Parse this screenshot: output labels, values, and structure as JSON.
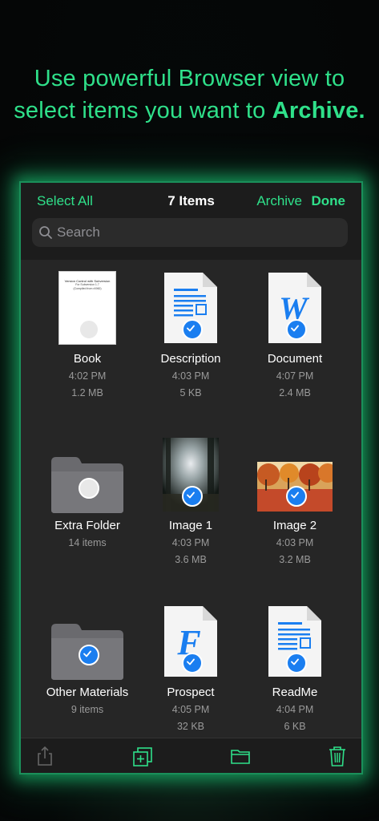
{
  "headline": {
    "line1": "Use powerful Browser view to",
    "line2_prefix": "select items you want to ",
    "line2_bold": "Archive."
  },
  "nav": {
    "select_all": "Select All",
    "title": "7 Items",
    "archive": "Archive",
    "done": "Done"
  },
  "search": {
    "placeholder": "Search"
  },
  "items": [
    {
      "name": "Book",
      "time": "4:02 PM",
      "size": "1.2 MB",
      "kind": "book",
      "selected": false
    },
    {
      "name": "Description",
      "time": "4:03 PM",
      "size": "5 KB",
      "kind": "doc",
      "selected": true
    },
    {
      "name": "Document",
      "time": "4:07 PM",
      "size": "2.4 MB",
      "kind": "word",
      "selected": true
    },
    {
      "name": "Extra Folder",
      "time": "14 items",
      "size": "",
      "kind": "folder",
      "selected": false
    },
    {
      "name": "Image 1",
      "time": "4:03 PM",
      "size": "3.6 MB",
      "kind": "photo-forest",
      "selected": true
    },
    {
      "name": "Image 2",
      "time": "4:03 PM",
      "size": "3.2 MB",
      "kind": "photo-autumn",
      "selected": true
    },
    {
      "name": "Other Materials",
      "time": "9 items",
      "size": "",
      "kind": "folder",
      "selected": true
    },
    {
      "name": "Prospect",
      "time": "4:05 PM",
      "size": "32 KB",
      "kind": "font",
      "selected": true
    },
    {
      "name": "ReadMe",
      "time": "4:04 PM",
      "size": "6 KB",
      "kind": "doc",
      "selected": true
    }
  ],
  "book_cover": {
    "title": "Version Control with Subversion",
    "subtitle": "For Subversion 1.7",
    "edition": "(Compiled from r4960)"
  },
  "toolbar": {
    "icons": [
      "share-icon",
      "duplicate-icon",
      "folder-icon",
      "trash-icon"
    ]
  },
  "colors": {
    "accent": "#2fe08a",
    "check": "#1a7ef0"
  }
}
